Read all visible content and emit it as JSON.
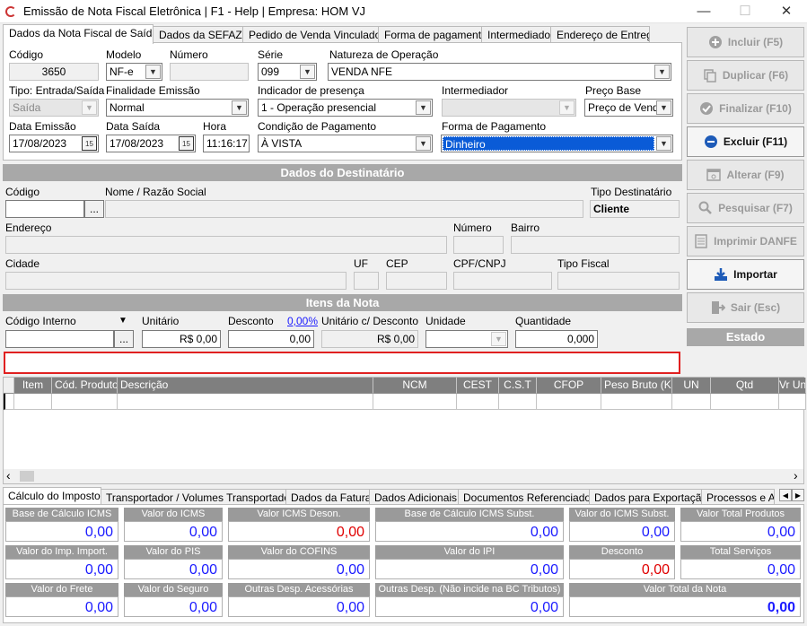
{
  "window": {
    "title": "Emissão de Nota Fiscal Eletrônica | F1 - Help | Empresa: HOM VJ",
    "minimize": "—",
    "maximize": "☐",
    "close": "✕"
  },
  "tabs": [
    "Dados da Nota Fiscal de Saída",
    "Dados da SEFAZ",
    "Pedido de Venda Vinculado",
    "Forma de pagamento",
    "Intermediador",
    "Endereço de Entrega"
  ],
  "nota": {
    "codigo_label": "Código",
    "codigo": "3650",
    "modelo_label": "Modelo",
    "modelo": "NF-e",
    "numero_label": "Número",
    "numero": "",
    "serie_label": "Série",
    "serie": "099",
    "natureza_label": "Natureza de Operação",
    "natureza": "VENDA NFE",
    "tipo_label": "Tipo: Entrada/Saída",
    "tipo": "Saída",
    "finalidade_label": "Finalidade Emissão",
    "finalidade": "Normal",
    "indicador_label": "Indicador de presença",
    "indicador": "1 - Operação presencial",
    "intermediador_label": "Intermediador",
    "intermediador": "",
    "preco_base_label": "Preço Base",
    "preco_base": "Preço de Venda",
    "data_emissao_label": "Data Emissão",
    "data_emissao": "17/08/2023",
    "data_saida_label": "Data Saída",
    "data_saida": "17/08/2023",
    "hora_label": "Hora",
    "hora": "11:16:17",
    "condicao_label": "Condição de Pagamento",
    "condicao": "À VISTA",
    "forma_label": "Forma de Pagamento",
    "forma": "Dinheiro",
    "calendar_icon_text": "15"
  },
  "destinatario": {
    "header": "Dados  do Destinatário",
    "codigo_label": "Código",
    "codigo": "",
    "lookup_btn": "...",
    "nome_label": "Nome / Razão Social",
    "nome": "",
    "tipo_label": "Tipo Destinatário",
    "tipo": "Cliente",
    "endereco_label": "Endereço",
    "numero_label": "Número",
    "bairro_label": "Bairro",
    "cidade_label": "Cidade",
    "uf_label": "UF",
    "cep_label": "CEP",
    "cpf_label": "CPF/CNPJ",
    "tipo_fiscal_label": "Tipo Fiscal"
  },
  "itens": {
    "header": "Itens da Nota",
    "codigo_label": "Código Interno",
    "codigo": "",
    "lookup_btn": "...",
    "unitario_label": "Unitário",
    "unitario": "R$ 0,00",
    "desconto_label": "Desconto",
    "desconto_pct": "0,00%",
    "desconto": "0,00",
    "unit_desc_label": "Unitário c/ Desconto",
    "unit_desc": "R$ 0,00",
    "unidade_label": "Unidade",
    "unidade": "",
    "quantidade_label": "Quantidade",
    "quantidade": "0,000"
  },
  "grid": {
    "columns": [
      "Item",
      "Cód. Produto",
      "Descrição",
      "NCM",
      "CEST",
      "C.S.T",
      "CFOP",
      "Peso Bruto (Kg)",
      "UN",
      "Qtd",
      "Vr Uni"
    ]
  },
  "side_buttons": [
    {
      "label": "Incluir (F5)",
      "enabled": false
    },
    {
      "label": "Duplicar (F6)",
      "enabled": false
    },
    {
      "label": "Finalizar (F10)",
      "enabled": false
    },
    {
      "label": "Excluir (F11)",
      "enabled": true
    },
    {
      "label": "Alterar (F9)",
      "enabled": false
    },
    {
      "label": "Pesquisar (F7)",
      "enabled": false
    },
    {
      "label": "Imprimir DANFE",
      "enabled": false
    },
    {
      "label": "Importar",
      "enabled": true
    },
    {
      "label": "Sair (Esc)",
      "enabled": false
    }
  ],
  "estado_label": "Estado",
  "scroll": {
    "left": "‹",
    "right": "›"
  },
  "bottom_tabs": [
    "Cálculo do Imposto",
    "Transportador / Volumes Transportados",
    "Dados da Fatura",
    "Dados Adicionais",
    "Documentos Referenciados",
    "Dados para Exportação",
    "Processos e Ato"
  ],
  "totals": {
    "base_icms_label": "Base de Cálculo ICMS",
    "base_icms": "0,00",
    "valor_icms_label": "Valor do ICMS",
    "valor_icms": "0,00",
    "icms_deson_label": "Valor ICMS Deson.",
    "icms_deson": "0,00",
    "base_icms_st_label": "Base de Cálculo ICMS Subst.",
    "base_icms_st": "0,00",
    "valor_icms_st_label": "Valor do ICMS Subst.",
    "valor_icms_st": "0,00",
    "total_produtos_label": "Valor Total Produtos",
    "total_produtos": "0,00",
    "imp_import_label": "Valor do Imp. Import.",
    "imp_import": "0,00",
    "pis_label": "Valor do PIS",
    "pis": "0,00",
    "cofins_label": "Valor do COFINS",
    "cofins": "0,00",
    "ipi_label": "Valor do IPI",
    "ipi": "0,00",
    "desconto_label": "Desconto",
    "desconto": "0,00",
    "servicos_label": "Total Serviços",
    "servicos": "0,00",
    "frete_label": "Valor do Frete",
    "frete": "0,00",
    "seguro_label": "Valor do Seguro",
    "seguro": "0,00",
    "outras_label": "Outras Desp. Acessórias",
    "outras": "0,00",
    "outras_nbc_label": "Outras Desp. (Não incide na BC Tributos)",
    "outras_nbc": "0,00",
    "total_nota_label": "Valor Total da Nota",
    "total_nota": "0,00"
  },
  "colors": {
    "value_blue": "#1a1aff",
    "value_red": "#e00000",
    "selection": "#0a5bd7"
  }
}
